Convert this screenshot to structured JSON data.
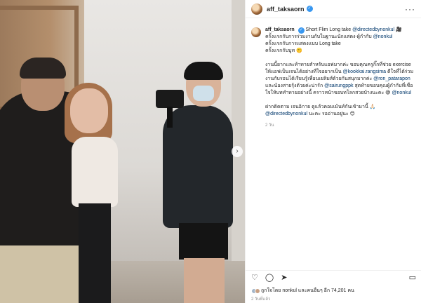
{
  "post": {
    "username": "aff_taksaorn",
    "verified_mark": "✓",
    "more_glyph": "···",
    "caption": {
      "line1_prefix": "Short Flim Long take ",
      "line1_mention": "@directedbynonkul",
      "line1_emoji": "🎥",
      "line2": "ครั้งแรกกับการร่วมงานกับในฐานะนักแสดง-ผู้กำกับ ",
      "line2_mention": "@nonkul",
      "line3": "ครั้งแรกกับการแสดงแบบ Long take",
      "line4": "ครั้งแรกกับบูท 🤫",
      "para2_a": "งานนี้ยากและท้าทายสำหรับแอฟมากค่ะ ขอบคุณครูกิ๊กที่ช่วย exercise ให้แอฟเป็นเจนได้อย่างที่ใจอยากเป็น ",
      "para2_mention1": "@kookkai.rangsima",
      "para2_b": " ดีใจที่ได้ร่วมงานกับรอนได้เรียนรู้เพื่อนเยลิมส์ด้วยกันสนุกมากค่ะ ",
      "para2_mention2": "@ron_patarapon",
      "para2_c": " และน้องสายรุ้งด้วยค่ะน่ารัก ",
      "para2_mention3": "@sairungppk",
      "para2_d": " สุดท้ายขอบคุณผู้กำกับที่เชื่อใจให้บททำทายอย่างนี้ คราวหน้าขอบทโลกสวยบ้างนะคะ 😅 ",
      "para2_mention4": "@nonkul",
      "para3_a": "ฝากติดตาม เจนอิกาย ดูแล้วคอมเม้นท์กันเข้ามานี้ 🙏🏻",
      "para3_mention": "@directedbynonkul",
      "para3_b": " นะคะ รออ่านอยู่นะ 😊",
      "time_ago": "2 วัน"
    },
    "actions": {
      "like_icon": "♡",
      "comment_icon": "◯",
      "share_icon": "➤",
      "bookmark_icon": "▭"
    },
    "likes_text": "ถูกใจโดย nonkul และคนอื่นๆ อีก 74,201 คน",
    "date": "2 วันที่แล้ว",
    "carousel_next": "›"
  }
}
